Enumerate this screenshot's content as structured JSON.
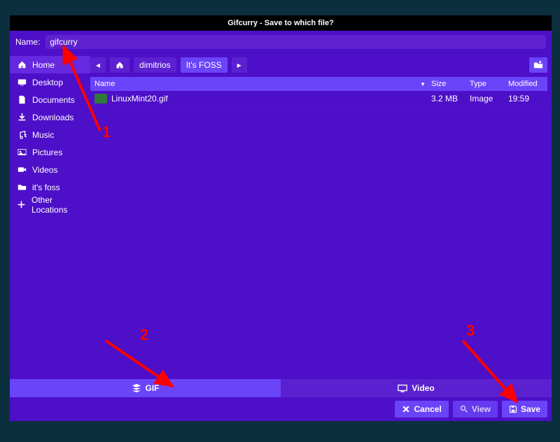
{
  "title": "Gifcurry - Save to which file?",
  "name_label": "Name:",
  "name_value": "gifcurry",
  "sidebar": {
    "items": [
      {
        "label": "Home",
        "icon": "home-icon",
        "selected": true
      },
      {
        "label": "Desktop",
        "icon": "desktop-icon",
        "selected": false
      },
      {
        "label": "Documents",
        "icon": "documents-icon",
        "selected": false
      },
      {
        "label": "Downloads",
        "icon": "downloads-icon",
        "selected": false
      },
      {
        "label": "Music",
        "icon": "music-icon",
        "selected": false
      },
      {
        "label": "Pictures",
        "icon": "pictures-icon",
        "selected": false
      },
      {
        "label": "Videos",
        "icon": "videos-icon",
        "selected": false
      },
      {
        "label": "it's foss",
        "icon": "folder-icon",
        "selected": false
      },
      {
        "label": "Other Locations",
        "icon": "plus-icon",
        "selected": false
      }
    ]
  },
  "path": {
    "back": "◂",
    "home": "⌂",
    "segments": [
      "dimitrios",
      "It's FOSS"
    ],
    "current_index": 1,
    "forward": "▸"
  },
  "columns": {
    "name": "Name",
    "size": "Size",
    "type": "Type",
    "modified": "Modified",
    "sort_indicator": "▼"
  },
  "files": [
    {
      "name": "LinuxMint20.gif",
      "size": "3.2 MB",
      "type": "Image",
      "modified": "19:59"
    }
  ],
  "formats": {
    "gif": {
      "label": "GIF",
      "active": true
    },
    "video": {
      "label": "Video",
      "active": false
    }
  },
  "actions": {
    "cancel": "Cancel",
    "view": "View",
    "save": "Save"
  },
  "annotations": {
    "n1": "1",
    "n2": "2",
    "n3": "3"
  }
}
